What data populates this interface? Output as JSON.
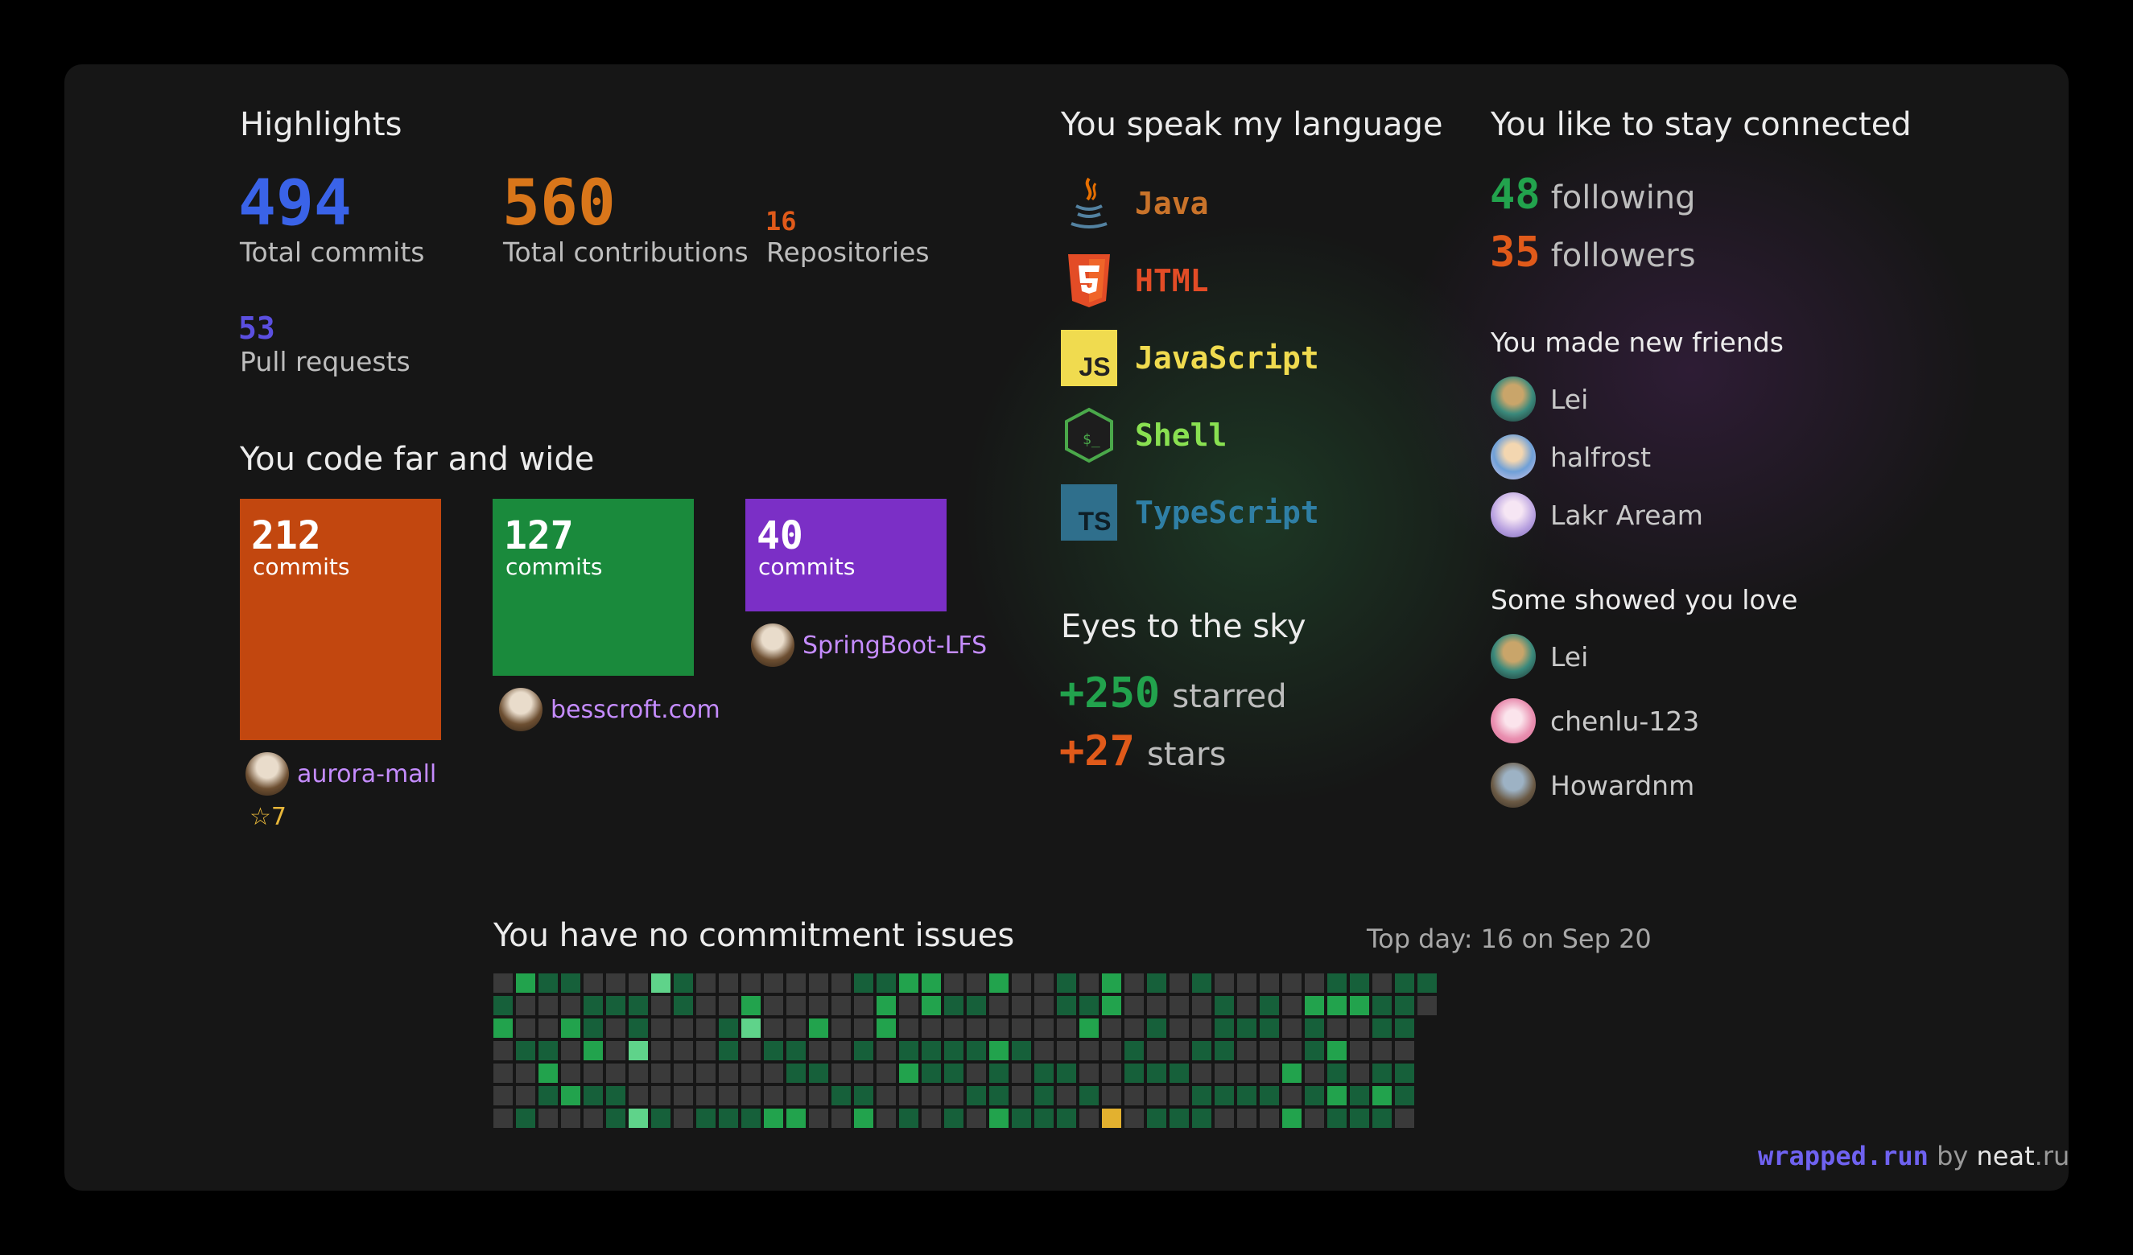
{
  "highlights": {
    "title": "Highlights",
    "total_commits": {
      "value": "494",
      "label": "Total commits"
    },
    "total_contributions": {
      "value": "560",
      "label": "Total contributions"
    },
    "repositories": {
      "value": "16",
      "label": "Repositories"
    },
    "pull_requests": {
      "value": "53",
      "label": "Pull requests"
    }
  },
  "code_wide": {
    "title": "You code far and wide",
    "repos": [
      {
        "commits": "212",
        "unit": "commits",
        "name": "aurora-mall",
        "stars": "7",
        "color": "#c2470f"
      },
      {
        "commits": "127",
        "unit": "commits",
        "name": "besscroft.com",
        "color": "#1a8a3c"
      },
      {
        "commits": "40",
        "unit": "commits",
        "name": "SpringBoot-LFS",
        "color": "#7b2fc6"
      }
    ]
  },
  "languages": {
    "title": "You speak my language",
    "items": [
      {
        "name": "Java",
        "icon": "java-icon",
        "color": "#c9732a"
      },
      {
        "name": "HTML",
        "icon": "html5-icon",
        "color": "#e34c26"
      },
      {
        "name": "JavaScript",
        "icon": "javascript-icon",
        "color": "#f0db4f"
      },
      {
        "name": "Shell",
        "icon": "shell-icon",
        "color": "#89e051"
      },
      {
        "name": "TypeScript",
        "icon": "typescript-icon",
        "color": "#3178c6"
      }
    ]
  },
  "sky": {
    "title": "Eyes to the sky",
    "starred": {
      "value": "+250",
      "label": "starred"
    },
    "stars": {
      "value": "+27",
      "label": "stars"
    }
  },
  "connected": {
    "title": "You like to stay connected",
    "following": {
      "value": "48",
      "label": "following"
    },
    "followers": {
      "value": "35",
      "label": "followers"
    }
  },
  "friends": {
    "title": "You made new friends",
    "people": [
      {
        "name": "Lei",
        "avatar": "octocat-avatar"
      },
      {
        "name": "halfrost",
        "avatar": "anime-avatar"
      },
      {
        "name": "Lakr Aream",
        "avatar": "anime-avatar"
      }
    ]
  },
  "love": {
    "title": "Some showed you love",
    "people": [
      {
        "name": "Lei",
        "avatar": "octocat-avatar"
      },
      {
        "name": "chenlu-123",
        "avatar": "pink-avatar"
      },
      {
        "name": "Howardnm",
        "avatar": "photo-avatar"
      }
    ]
  },
  "commitment": {
    "title": "You have no commitment issues",
    "top_day": "Top day: 16 on Sep 20",
    "levels": "0120000200100110012101020020011201001000110113003300000111000000000001001100102300010001002000110200201000000010100101212200002001201220110001011010101010200211200010010000111110010101200102200004000110010101010000101100101101110100010010011001000002020211010120212112000110110121111011010",
    "colors": [
      "#3a3a3a",
      "#16603a",
      "#22a34d",
      "#5fd38a",
      "#e3b12f"
    ]
  },
  "footer": {
    "brand": "wrapped.run",
    "by": "by",
    "neat": "neat",
    "run": ".run"
  }
}
